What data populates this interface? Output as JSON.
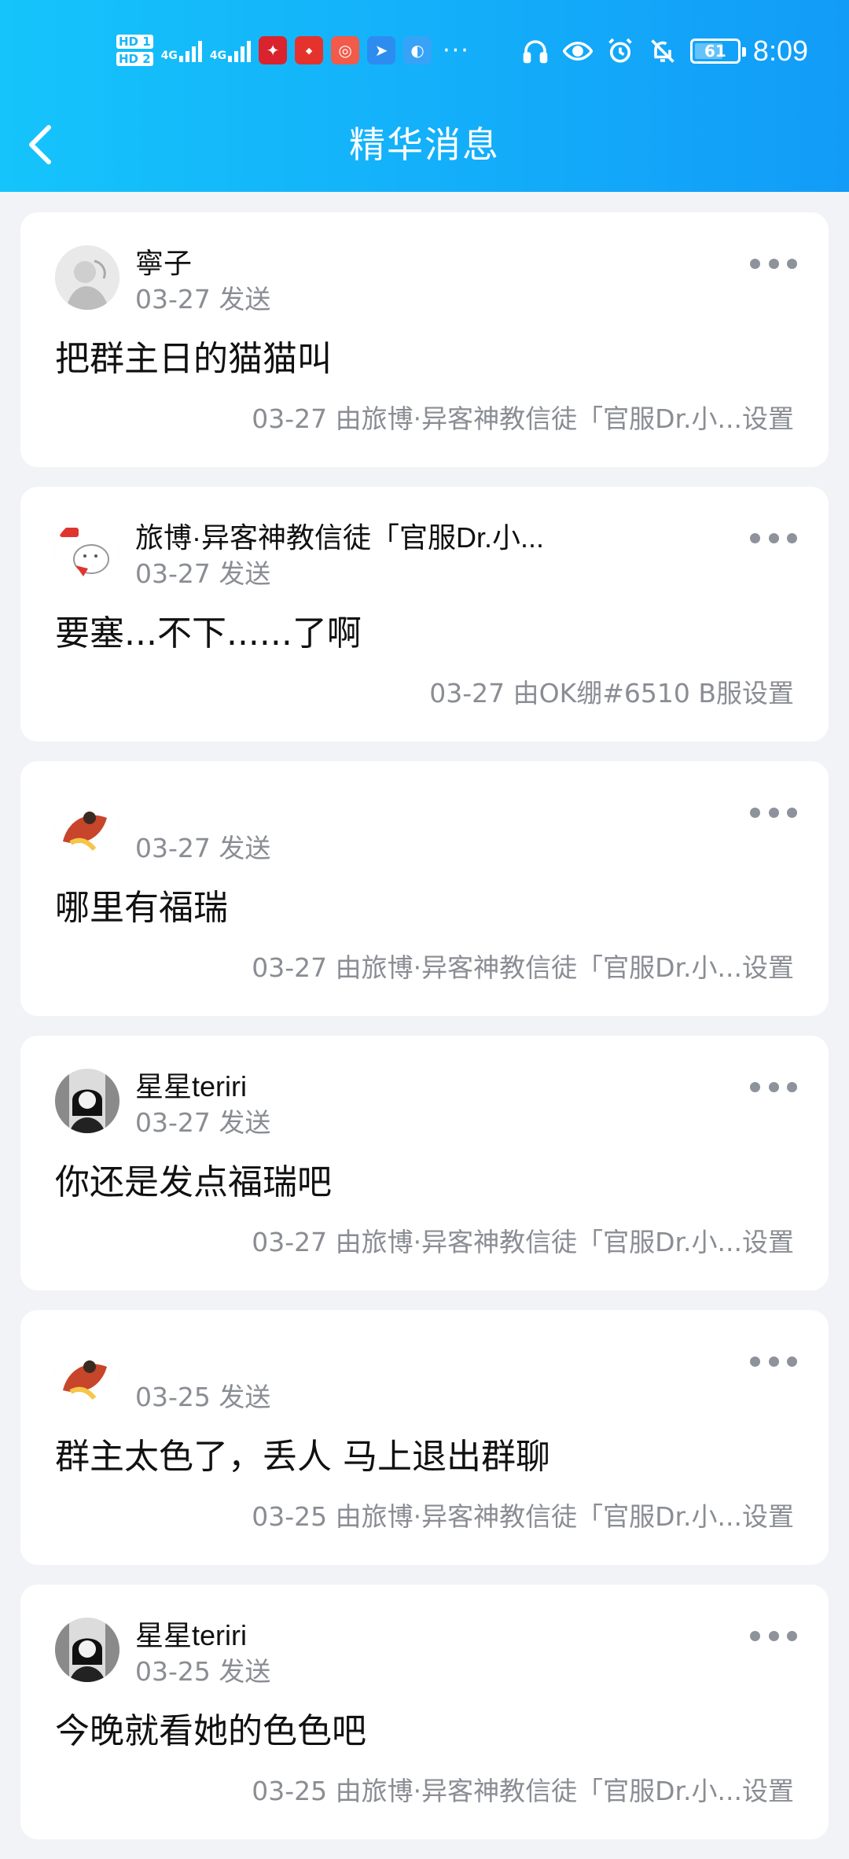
{
  "status_bar": {
    "sim1": "HD 1",
    "sim2": "HD 2",
    "net1": "4G",
    "net2": "4G",
    "battery": "61",
    "time": "8:09",
    "more": "···"
  },
  "title_bar": {
    "title": "精华消息"
  },
  "messages": [
    {
      "author": "寧子",
      "sent": "03-27 发送",
      "content": "把群主日的猫猫叫",
      "set_by": "03-27 由旅博·异客神教信徒「官服Dr.小...设置"
    },
    {
      "author": "旅博·异客神教信徒「官服Dr.小...",
      "sent": "03-27 发送",
      "content": "要塞...不下......了啊",
      "set_by": "03-27 由OK绷#6510 B服设置"
    },
    {
      "author": "",
      "sent": "03-27 发送",
      "content": "哪里有福瑞",
      "set_by": "03-27 由旅博·异客神教信徒「官服Dr.小...设置"
    },
    {
      "author": "星星teriri",
      "sent": "03-27 发送",
      "content": "你还是发点福瑞吧",
      "set_by": "03-27 由旅博·异客神教信徒「官服Dr.小...设置"
    },
    {
      "author": "",
      "sent": "03-25 发送",
      "content": "群主太色了，丢人 马上退出群聊",
      "set_by": "03-25 由旅博·异客神教信徒「官服Dr.小...设置"
    },
    {
      "author": "星星teriri",
      "sent": "03-25 发送",
      "content": "今晚就看她的色色吧",
      "set_by": "03-25 由旅博·异客神教信徒「官服Dr.小...设置"
    }
  ],
  "icons": {
    "back": "chevron-left-icon",
    "menu": "more-horizontal-icon",
    "status": [
      "headphones-icon",
      "eye-icon",
      "alarm-icon",
      "mute-bell-icon"
    ]
  },
  "colors": {
    "header_start": "#15c4fb",
    "header_end": "#129cf8",
    "background": "#f2f3f6",
    "secondary_text": "#8a8d93"
  }
}
